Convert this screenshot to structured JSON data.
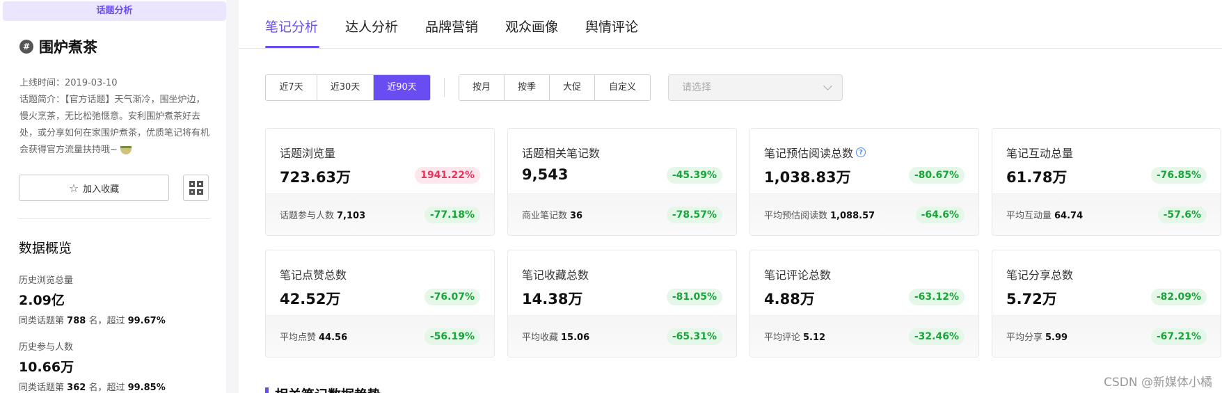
{
  "sidebar": {
    "badge": "话题分析",
    "topic_name": "围炉煮茶",
    "launch_date": "上线时间：2019-03-10",
    "intro": "话题简介：【官方话题】天气渐冷，围坐炉边，慢火烹茶，无比松弛惬意。安利围炉煮茶好去处，或分享如何在家围炉煮茶，优质笔记将有机会获得官方流量扶持哦~",
    "favorite_label": "加入收藏",
    "overview_title": "数据概览",
    "history": [
      {
        "label": "历史浏览总量",
        "value": "2.09亿",
        "rank_prefix": "同类话题第",
        "rank": "788",
        "rank_mid": "名，超过",
        "percent": "99.67%"
      },
      {
        "label": "历史参与人数",
        "value": "10.66万",
        "rank_prefix": "同类话题第",
        "rank": "362",
        "rank_mid": "名，超过",
        "percent": "99.85%"
      }
    ]
  },
  "tabs": [
    "笔记分析",
    "达人分析",
    "品牌营销",
    "观众画像",
    "舆情评论"
  ],
  "filters": {
    "ranges": [
      "近7天",
      "近30天",
      "近90天"
    ],
    "periods": [
      "按月",
      "按季",
      "大促",
      "自定义"
    ],
    "select_placeholder": "请选择"
  },
  "cards": [
    {
      "title": "话题浏览量",
      "value": "723.63万",
      "pct": "1941.22%",
      "trend": "up",
      "foot_label": "话题参与人数",
      "foot_value": "7,103",
      "foot_pct": "-77.18%"
    },
    {
      "title": "话题相关笔记数",
      "value": "9,543",
      "pct": "-45.39%",
      "trend": "down",
      "foot_label": "商业笔记数",
      "foot_value": "36",
      "foot_pct": "-78.57%"
    },
    {
      "title": "笔记预估阅读总数",
      "value": "1,038.83万",
      "pct": "-80.67%",
      "trend": "down",
      "foot_label": "平均预估阅读数",
      "foot_value": "1,088.57",
      "foot_pct": "-64.6%"
    },
    {
      "title": "笔记互动总量",
      "value": "61.78万",
      "pct": "-76.85%",
      "trend": "down",
      "foot_label": "平均互动量",
      "foot_value": "64.74",
      "foot_pct": "-57.6%"
    },
    {
      "title": "笔记点赞总数",
      "value": "42.52万",
      "pct": "-76.07%",
      "trend": "down",
      "foot_label": "平均点赞",
      "foot_value": "44.56",
      "foot_pct": "-56.19%"
    },
    {
      "title": "笔记收藏总数",
      "value": "14.38万",
      "pct": "-81.05%",
      "trend": "down",
      "foot_label": "平均收藏",
      "foot_value": "15.06",
      "foot_pct": "-65.31%"
    },
    {
      "title": "笔记评论总数",
      "value": "4.88万",
      "pct": "-63.12%",
      "trend": "down",
      "foot_label": "平均评论",
      "foot_value": "5.12",
      "foot_pct": "-32.46%"
    },
    {
      "title": "笔记分享总数",
      "value": "5.72万",
      "pct": "-82.09%",
      "trend": "down",
      "foot_label": "平均分享",
      "foot_value": "5.99",
      "foot_pct": "-67.21%"
    }
  ],
  "section_title": "相关笔记数据趋势",
  "watermark": "CSDN @新媒体小橘",
  "colors": {
    "accent": "#6a4df2",
    "down": "#1aa53a",
    "up": "#e8345c"
  }
}
